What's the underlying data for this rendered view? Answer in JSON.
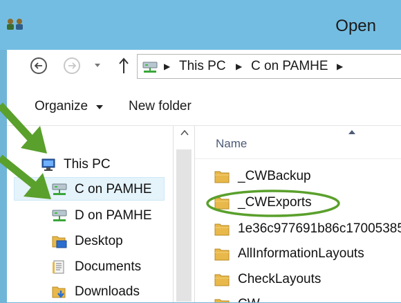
{
  "window": {
    "title": "Open"
  },
  "navigation": {
    "breadcrumbs": [
      "This PC",
      "C on PAMHE"
    ]
  },
  "toolbar": {
    "organize_label": "Organize",
    "new_folder_label": "New folder"
  },
  "nav_pane": {
    "items": [
      {
        "label": "This PC",
        "icon": "monitor-icon"
      },
      {
        "label": "C on PAMHE",
        "icon": "network-drive-icon",
        "selected": true
      },
      {
        "label": "D on PAMHE",
        "icon": "network-drive-icon"
      },
      {
        "label": "Desktop",
        "icon": "desktop-folder-icon"
      },
      {
        "label": "Documents",
        "icon": "documents-icon"
      },
      {
        "label": "Downloads",
        "icon": "downloads-icon"
      }
    ]
  },
  "file_list": {
    "column_name": "Name",
    "items": [
      {
        "name": "_CWBackup",
        "icon": "folder-icon"
      },
      {
        "name": "_CWExports",
        "icon": "folder-icon",
        "circled": true
      },
      {
        "name": "1e36c977691b86c17005385",
        "icon": "folder-icon"
      },
      {
        "name": "AllInformationLayouts",
        "icon": "folder-icon"
      },
      {
        "name": "CheckLayouts",
        "icon": "folder-icon"
      },
      {
        "name": "CW",
        "icon": "folder-icon"
      }
    ]
  },
  "colors": {
    "titlebar": "#74bde2",
    "selection": "#e5f3fb",
    "annotation_green": "#5aa02c",
    "folder": "#e8b84a"
  }
}
